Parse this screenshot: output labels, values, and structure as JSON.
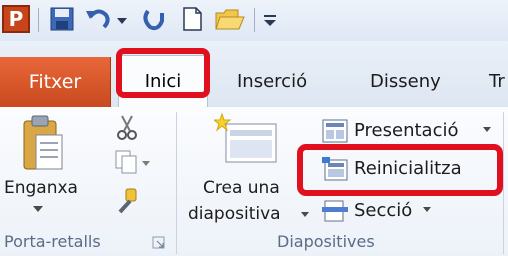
{
  "quick_access": {
    "app_letter": "P",
    "icons": [
      "powerpoint-app-icon",
      "save-icon",
      "undo-icon",
      "undo-dropdown-icon",
      "redo-icon",
      "new-document-icon",
      "open-folder-icon",
      "customize-qat-icon"
    ]
  },
  "tabs": {
    "file": "Fitxer",
    "home": "Inici",
    "insert": "Inserció",
    "design": "Disseny",
    "partial_next": "Tr"
  },
  "clipboard_group": {
    "paste": "Enganxa",
    "label": "Porta-retalls"
  },
  "slides_group": {
    "new_slide_line1": "Crea una",
    "new_slide_line2": "diapositiva",
    "layout": "Presentació",
    "reset": "Reinicialitza",
    "section": "Secció",
    "label": "Diapositives"
  },
  "colors": {
    "highlight": "#e0101f",
    "file_tab": "#d4552a"
  }
}
